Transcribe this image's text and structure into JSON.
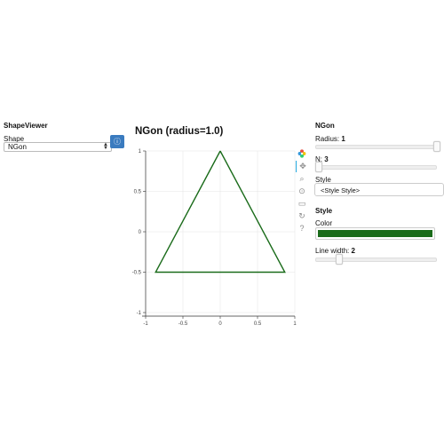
{
  "left_panel": {
    "title": "ShapeViewer",
    "shape_label": "Shape",
    "shape_value": "NGon",
    "info_icon": "info-icon"
  },
  "plot": {
    "title": "NGon (radius=1.0)",
    "line_color": "#1a6b1a"
  },
  "chart_data": {
    "type": "line",
    "title": "NGon (radius=1.0)",
    "xlabel": "",
    "ylabel": "",
    "xlim": [
      -1,
      1
    ],
    "ylim": [
      -1,
      1
    ],
    "x_ticks": [
      "-1",
      "-0.5",
      "0",
      "0.5",
      "1"
    ],
    "y_ticks": [
      "1",
      "0.5",
      "0",
      "-0.5",
      "-1"
    ],
    "grid": true,
    "series": [
      {
        "x": [
          0,
          -0.866,
          0.866,
          0
        ],
        "y": [
          1,
          -0.5,
          -0.5,
          1
        ]
      }
    ]
  },
  "toolbar": {
    "tools": [
      "bokeh-logo-icon",
      "pan-icon",
      "box-zoom-icon",
      "wheel-zoom-icon",
      "save-icon",
      "reset-icon",
      "help-icon"
    ]
  },
  "right_panel": {
    "title": "NGon",
    "radius_label": "Radius:",
    "radius_value": "1",
    "radius_level": 1.0,
    "n_label": "N:",
    "n_value": "3",
    "n_level": 0.0,
    "style_label": "Style",
    "style_value": "<Style Style>",
    "style_section_title": "Style",
    "color_label": "Color",
    "color_value": "#1a6b1a",
    "line_width_label": "Line width:",
    "line_width_value": "2",
    "line_width_level": 0.18
  }
}
